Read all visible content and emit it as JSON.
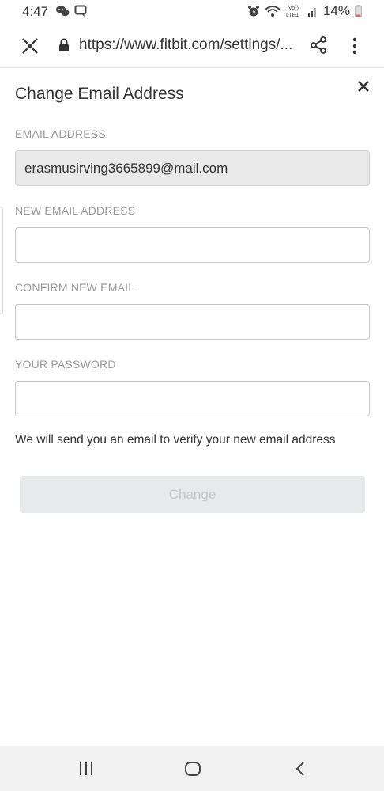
{
  "status_bar": {
    "time": "4:47",
    "battery_percent": "14%",
    "left_icons": [
      "chat-bubbles-icon",
      "message-icon"
    ],
    "right_icons": [
      "alarm-icon",
      "wifi-icon",
      "volte-icon",
      "signal-icon",
      "battery-icon"
    ],
    "volte_label_top": "Vo))",
    "volte_label_bottom": "LTE1",
    "battery_color": "#e66a5a"
  },
  "browser": {
    "url": "https://www.fitbit.com/settings/..."
  },
  "modal": {
    "title": "Change Email Address",
    "fields": [
      {
        "label": "EMAIL ADDRESS",
        "value": "erasmusirving3665899@mail.com",
        "readonly": true
      },
      {
        "label": "NEW EMAIL ADDRESS",
        "value": "",
        "placeholder": ""
      },
      {
        "label": "CONFIRM NEW EMAIL",
        "value": "",
        "placeholder": ""
      },
      {
        "label": "YOUR PASSWORD",
        "value": "",
        "placeholder": ""
      }
    ],
    "info_text": "We will send you an email to verify your new email address",
    "submit_label": "Change"
  },
  "colors": {
    "disabled_button_bg": "#e8e9eb",
    "disabled_button_text": "#c5c6c8",
    "label_gray": "#9a9a9a",
    "readonly_field_bg": "#e9e9e9"
  }
}
